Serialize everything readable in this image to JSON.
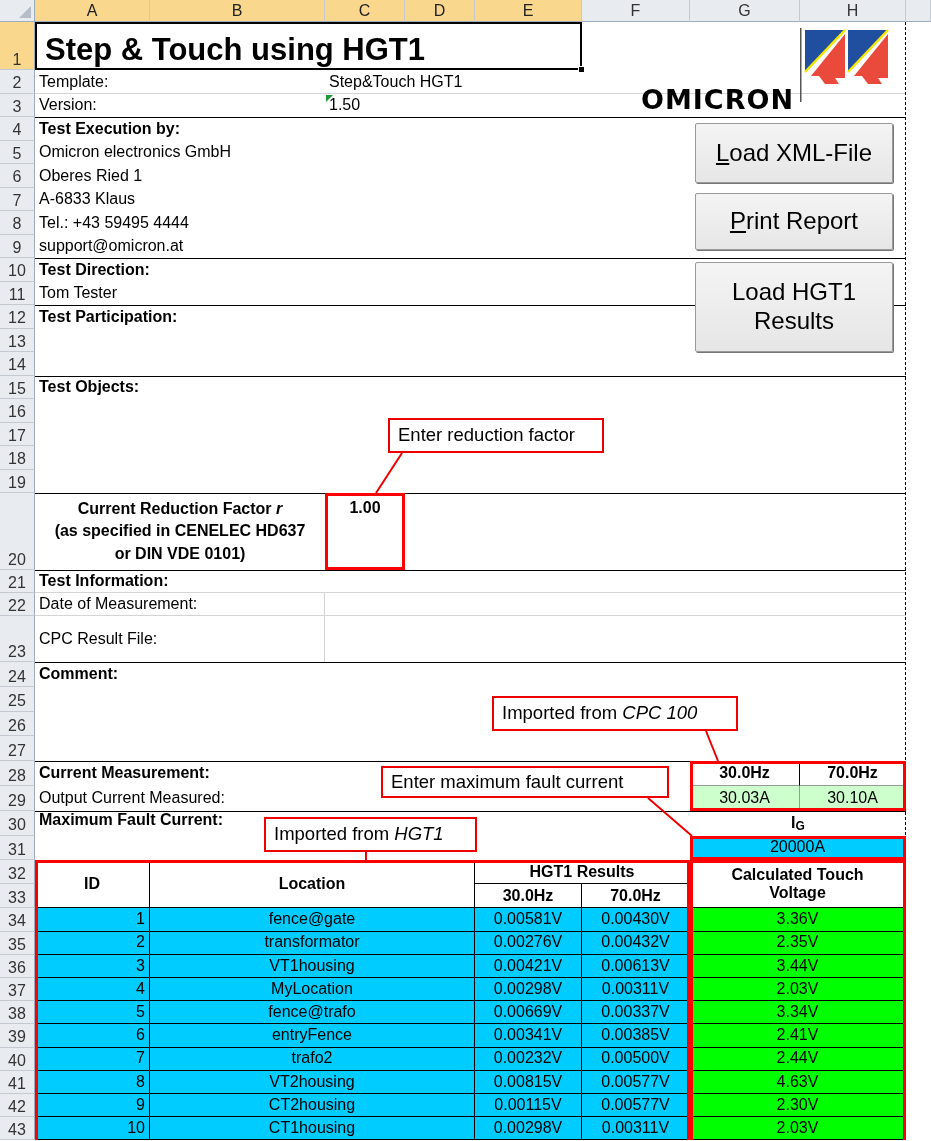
{
  "columns": [
    {
      "label": "A",
      "selected": true
    },
    {
      "label": "B",
      "selected": true
    },
    {
      "label": "C",
      "selected": true
    },
    {
      "label": "D",
      "selected": true
    },
    {
      "label": "E",
      "selected": true
    },
    {
      "label": "F",
      "selected": false
    },
    {
      "label": "G",
      "selected": false
    },
    {
      "label": "H",
      "selected": false
    }
  ],
  "rows": [
    {
      "label": "1",
      "selected": true
    },
    {
      "label": "2",
      "selected": false
    },
    {
      "label": "3",
      "selected": false
    },
    {
      "label": "4",
      "selected": false
    },
    {
      "label": "5",
      "selected": false
    },
    {
      "label": "6",
      "selected": false
    },
    {
      "label": "7",
      "selected": false
    },
    {
      "label": "8",
      "selected": false
    },
    {
      "label": "9",
      "selected": false
    },
    {
      "label": "10",
      "selected": false
    },
    {
      "label": "11",
      "selected": false
    },
    {
      "label": "12",
      "selected": false
    },
    {
      "label": "13",
      "selected": false
    },
    {
      "label": "14",
      "selected": false
    },
    {
      "label": "15",
      "selected": false
    },
    {
      "label": "16",
      "selected": false
    },
    {
      "label": "17",
      "selected": false
    },
    {
      "label": "18",
      "selected": false
    },
    {
      "label": "19",
      "selected": false
    },
    {
      "label": "20",
      "selected": false
    },
    {
      "label": "21",
      "selected": false
    },
    {
      "label": "22",
      "selected": false
    },
    {
      "label": "23",
      "selected": false
    },
    {
      "label": "24",
      "selected": false
    },
    {
      "label": "25",
      "selected": false
    },
    {
      "label": "26",
      "selected": false
    },
    {
      "label": "27",
      "selected": false
    },
    {
      "label": "28",
      "selected": false
    },
    {
      "label": "29",
      "selected": false
    },
    {
      "label": "30",
      "selected": false
    },
    {
      "label": "31",
      "selected": false
    },
    {
      "label": "32",
      "selected": false
    },
    {
      "label": "33",
      "selected": false
    },
    {
      "label": "34",
      "selected": false
    },
    {
      "label": "35",
      "selected": false
    },
    {
      "label": "36",
      "selected": false
    },
    {
      "label": "37",
      "selected": false
    },
    {
      "label": "38",
      "selected": false
    },
    {
      "label": "39",
      "selected": false
    },
    {
      "label": "40",
      "selected": false
    },
    {
      "label": "41",
      "selected": false
    },
    {
      "label": "42",
      "selected": false
    },
    {
      "label": "43",
      "selected": false
    }
  ],
  "title": "Step & Touch using HGT1",
  "header_fields": [
    {
      "label": "Template:",
      "value": "Step&Touch HGT1",
      "flagged": false
    },
    {
      "label": "Version:",
      "value": "1.50",
      "flagged": true
    }
  ],
  "logo": {
    "text": "OMICRON"
  },
  "buttons": [
    {
      "label": "Load XML-File",
      "accelerator": true
    },
    {
      "label": "Print Report",
      "accelerator": true
    },
    {
      "label": "Load HGT1 Results",
      "accelerator": false
    }
  ],
  "execution": {
    "heading": "Test Execution by:",
    "lines": [
      "Omicron electronics GmbH",
      "Oberes Ried 1",
      "A-6833 Klaus",
      "Tel.: +43 59495 4444",
      "support@omicron.at"
    ]
  },
  "direction": {
    "heading": "Test Direction:",
    "lines": [
      "Tom Tester"
    ]
  },
  "participation": {
    "heading": "Test Participation:"
  },
  "objects": {
    "heading": "Test Objects:"
  },
  "reduction": {
    "label_lines": [
      "Current Reduction Factor *r*",
      "(as specified in CENELEC HD637",
      "or DIN VDE 0101)"
    ],
    "value": "1.00"
  },
  "information": {
    "heading": "Test Information:",
    "fields": [
      "Date of Measurement:",
      "CPC Result File:"
    ]
  },
  "comment": {
    "heading": "Comment:"
  },
  "measurement": {
    "heading": "Current Measurement:",
    "frequencies": [
      "30.0Hz",
      "70.0Hz"
    ],
    "label": "Output Current Measured:",
    "values": [
      "30.03A",
      "30.10A"
    ]
  },
  "fault": {
    "label": "Maximum Fault Current:",
    "symbol": "I$_{G}$",
    "value": "20000A"
  },
  "table": {
    "id_header": "ID",
    "location_header": "Location",
    "group_header": "HGT1 Results",
    "frequencies": [
      "30.0Hz",
      "70.0Hz"
    ],
    "touch_header": "Calculated Touch Voltage",
    "rows": [
      {
        "id": "1",
        "location": "fence@gate",
        "v30": "0.00581V",
        "v70": "0.00430V",
        "touch": "3.36V"
      },
      {
        "id": "2",
        "location": "transformator",
        "v30": "0.00276V",
        "v70": "0.00432V",
        "touch": "2.35V"
      },
      {
        "id": "3",
        "location": "VT1housing",
        "v30": "0.00421V",
        "v70": "0.00613V",
        "touch": "3.44V"
      },
      {
        "id": "4",
        "location": "MyLocation",
        "v30": "0.00298V",
        "v70": "0.00311V",
        "touch": "2.03V"
      },
      {
        "id": "5",
        "location": "fence@trafo",
        "v30": "0.00669V",
        "v70": "0.00337V",
        "touch": "3.34V"
      },
      {
        "id": "6",
        "location": "entryFence",
        "v30": "0.00341V",
        "v70": "0.00385V",
        "touch": "2.41V"
      },
      {
        "id": "7",
        "location": "trafo2",
        "v30": "0.00232V",
        "v70": "0.00500V",
        "touch": "2.44V"
      },
      {
        "id": "8",
        "location": "VT2housing",
        "v30": "0.00815V",
        "v70": "0.00577V",
        "touch": "4.63V"
      },
      {
        "id": "9",
        "location": "CT2housing",
        "v30": "0.00115V",
        "v70": "0.00577V",
        "touch": "2.30V"
      },
      {
        "id": "10",
        "location": "CT1housing",
        "v30": "0.00298V",
        "v70": "0.00311V",
        "touch": "2.03V"
      }
    ]
  },
  "callouts": [
    {
      "text": "Enter reduction factor"
    },
    {
      "text": "Imported from *CPC 100*"
    },
    {
      "text": "Enter maximum fault current"
    },
    {
      "text": "Imported from *HGT1*"
    }
  ]
}
